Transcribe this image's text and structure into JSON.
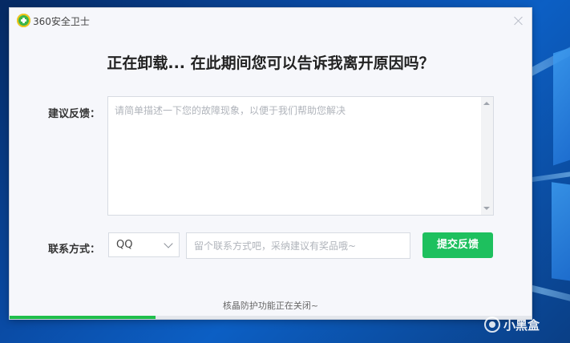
{
  "window": {
    "app_title": "360安全卫士",
    "heading": "正在卸载... 在此期间您可以告诉我离开原因吗？"
  },
  "feedback": {
    "label": "建议反馈：",
    "placeholder": "请简单描述一下您的故障现象，以便于我们帮助您解决"
  },
  "contact": {
    "label": "联系方式：",
    "method_selected": "QQ",
    "input_placeholder": "留个联系方式吧，采纳建议有奖品哦~",
    "submit_label": "提交反馈"
  },
  "status": {
    "text": "核晶防护功能正在关闭~",
    "progress_fraction": 0.28,
    "progress_color": "#1fbe4b"
  },
  "watermark": {
    "text": "小黑盒"
  },
  "colors": {
    "accent_green": "#1ec05e",
    "desktop_blue": "#0a3f86"
  },
  "icons": {
    "app_logo": "360-logo-icon",
    "close": "close-icon",
    "dropdown": "chevron-down-icon"
  }
}
